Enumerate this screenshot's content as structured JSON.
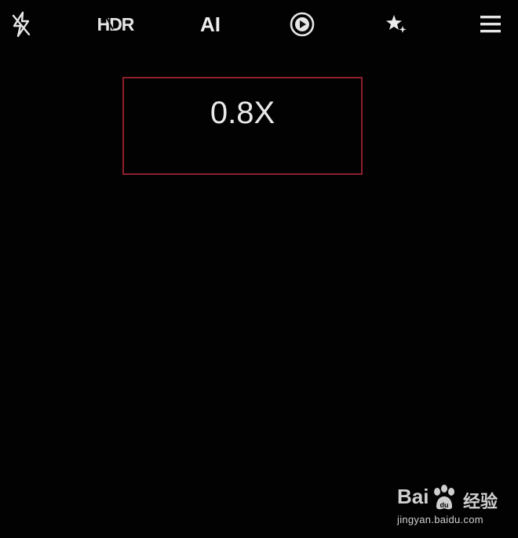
{
  "top_bar": {
    "flash_icon": "flash-off-icon",
    "hdr_label": "HDR",
    "hdr_state": "off",
    "ai_label": "AI",
    "live_icon": "live-photo-icon",
    "beauty_icon": "beauty-filter-icon",
    "menu_icon": "menu-icon"
  },
  "zoom": {
    "label": "0.8X",
    "highlight_color": "#8f1f2b"
  },
  "watermark": {
    "brand_a": "Bai",
    "brand_b": "经验",
    "url": "jingyan.baidu.com"
  }
}
